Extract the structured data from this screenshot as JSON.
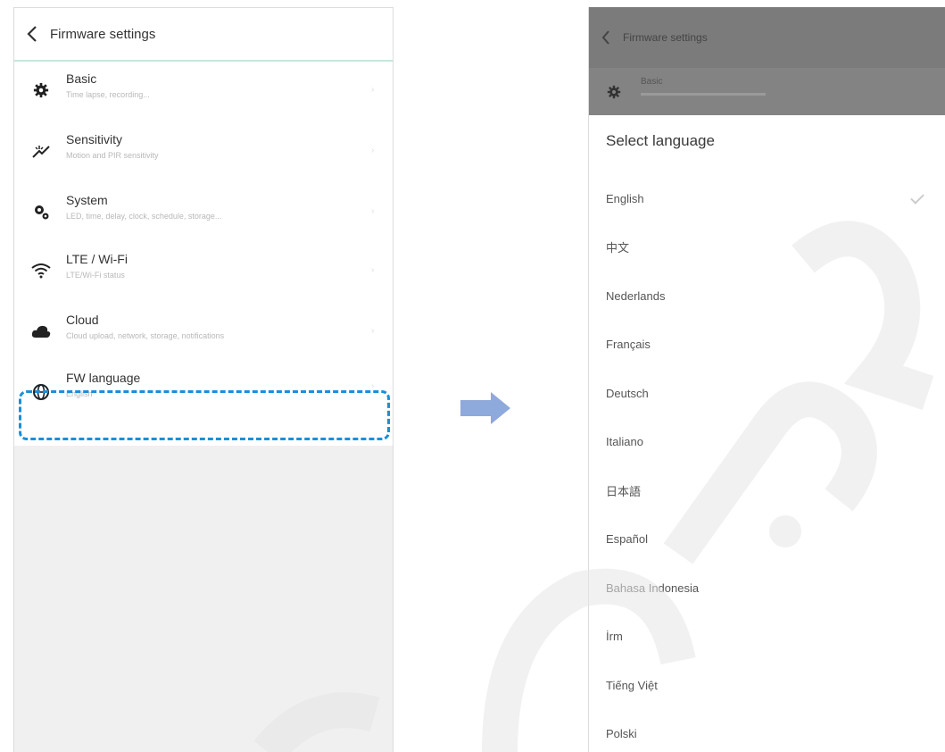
{
  "left": {
    "header_title": "Firmware settings",
    "items": [
      {
        "title": "Basic",
        "subtitle": "Time lapse, recording..."
      },
      {
        "title": "Sensitivity",
        "subtitle": "Motion and PIR sensitivity"
      },
      {
        "title": "System",
        "subtitle": "LED, time, delay, clock, schedule, storage..."
      },
      {
        "title": "LTE / Wi-Fi",
        "subtitle": "LTE/Wi-Fi status"
      },
      {
        "title": "Cloud",
        "subtitle": "Cloud upload, network, storage, notifications"
      },
      {
        "title": "FW language",
        "subtitle": "English"
      }
    ]
  },
  "right": {
    "header_title": "Firmware settings",
    "basic_label": "Basic",
    "dialog_title": "Select language",
    "languages": [
      "English",
      "中文",
      "Nederlands",
      "Français",
      "Deutsch",
      "Italiano",
      "日本語",
      "Español",
      "Bahasa Indonesia",
      "İrm",
      "Tiếng Việt",
      "Polski"
    ],
    "selected": "English"
  },
  "colors": {
    "highlight": "#1a8fd8",
    "arrow": "#8ea9db",
    "divider": "#c8e6dc",
    "overlay": "#7b7b7b"
  }
}
